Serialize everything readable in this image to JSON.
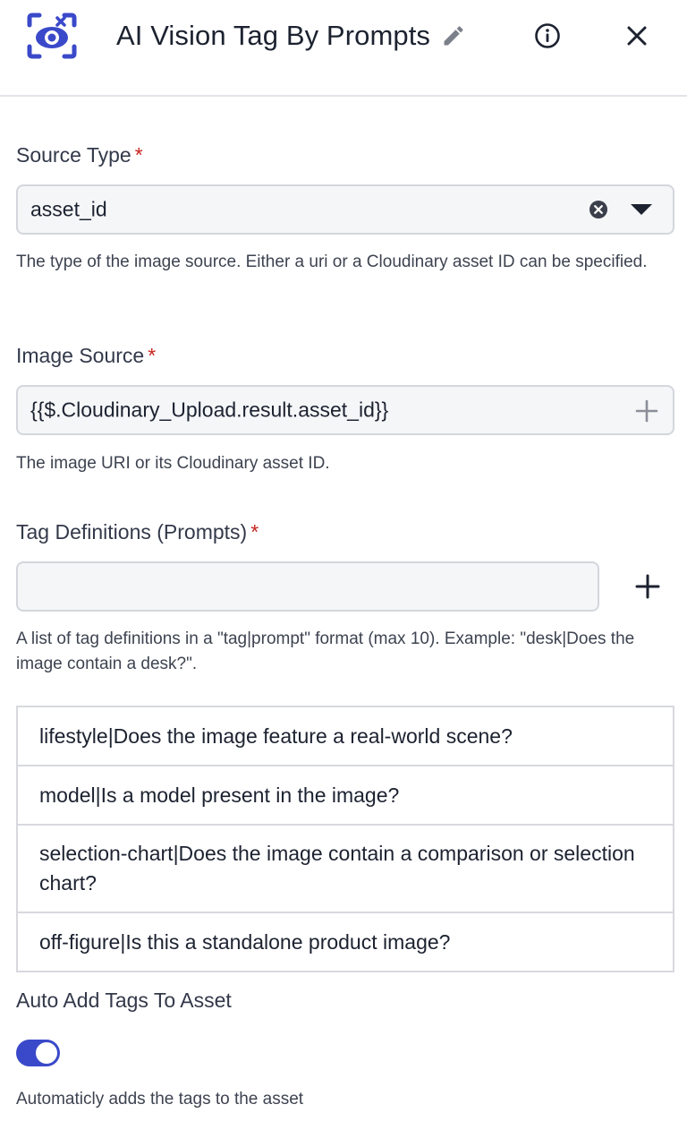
{
  "header": {
    "title": "AI Vision Tag By Prompts",
    "logo_icon": "eye-scan-logo-icon",
    "edit_icon": "pencil-icon",
    "info_icon": "info-icon",
    "close_icon": "close-icon"
  },
  "source_type": {
    "label": "Source Type",
    "required_mark": "*",
    "value": "asset_id",
    "help": "The type of the image source. Either a uri or a Cloudinary asset ID can be specified."
  },
  "image_source": {
    "label": "Image Source",
    "required_mark": "*",
    "value": "{{$.Cloudinary_Upload.result.asset_id}}",
    "help": "The image URI or its Cloudinary asset ID."
  },
  "tag_definitions": {
    "label": "Tag Definitions (Prompts)",
    "required_mark": "*",
    "input_value": "",
    "help": "A list of tag definitions in a \"tag|prompt\" format (max 10). Example: \"desk|Does the image contain a desk?\".",
    "items": [
      "lifestyle|Does the image feature a real-world scene?",
      "model|Is a model present in the image?",
      "selection-chart|Does the image contain a comparison or selection chart?",
      "off-figure|Is this a standalone product image?"
    ]
  },
  "auto_add": {
    "label": "Auto Add Tags To Asset",
    "enabled": true,
    "help": "Automaticly adds the tags to the asset"
  },
  "colors": {
    "accent": "#3a49c9",
    "required": "#c8241f",
    "field_bg": "#f5f6f8",
    "border": "#d3d6dc"
  }
}
